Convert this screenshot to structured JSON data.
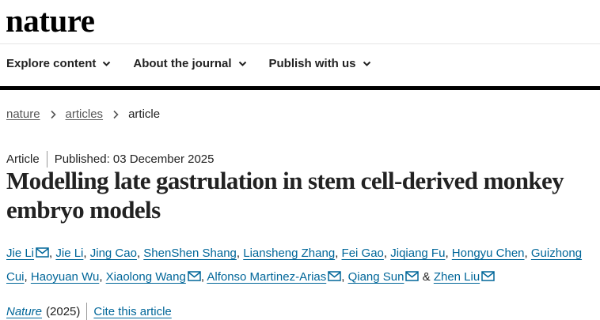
{
  "header": {
    "logo": "nature"
  },
  "nav": {
    "items": [
      {
        "label": "Explore content"
      },
      {
        "label": "About the journal"
      },
      {
        "label": "Publish with us"
      }
    ]
  },
  "breadcrumb": {
    "items": [
      {
        "label": "nature"
      },
      {
        "label": "articles"
      }
    ],
    "current": "article"
  },
  "article": {
    "type": "Article",
    "published": "Published: 03 December 2025",
    "title": "Modelling late gastrulation in stem cell-derived monkey embryo models",
    "authors": [
      {
        "name": "Jie Li",
        "email": true
      },
      {
        "name": "Jie Li",
        "email": false
      },
      {
        "name": "Jing Cao",
        "email": false
      },
      {
        "name": "ShenShen Shang",
        "email": false
      },
      {
        "name": "Liansheng Zhang",
        "email": false
      },
      {
        "name": "Fei Gao",
        "email": false
      },
      {
        "name": "Jiqiang Fu",
        "email": false
      },
      {
        "name": "Hongyu Chen",
        "email": false
      },
      {
        "name": "Guizhong Cui",
        "email": false
      },
      {
        "name": "Haoyuan Wu",
        "email": false
      },
      {
        "name": "Xiaolong Wang",
        "email": true
      },
      {
        "name": "Alfonso Martinez-Arias",
        "email": true
      },
      {
        "name": "Qiang Sun",
        "email": true
      },
      {
        "name": "Zhen Liu",
        "email": true
      }
    ],
    "journal": "Nature",
    "year": "(2025)",
    "cite_label": "Cite this article"
  },
  "colors": {
    "link": "#006699",
    "text": "#222222",
    "bar": "#000000"
  },
  "icons": {
    "nav_arrow": "chevron-down-icon",
    "crumb_sep": "chevron-right-icon",
    "author_contact": "mail-icon"
  }
}
